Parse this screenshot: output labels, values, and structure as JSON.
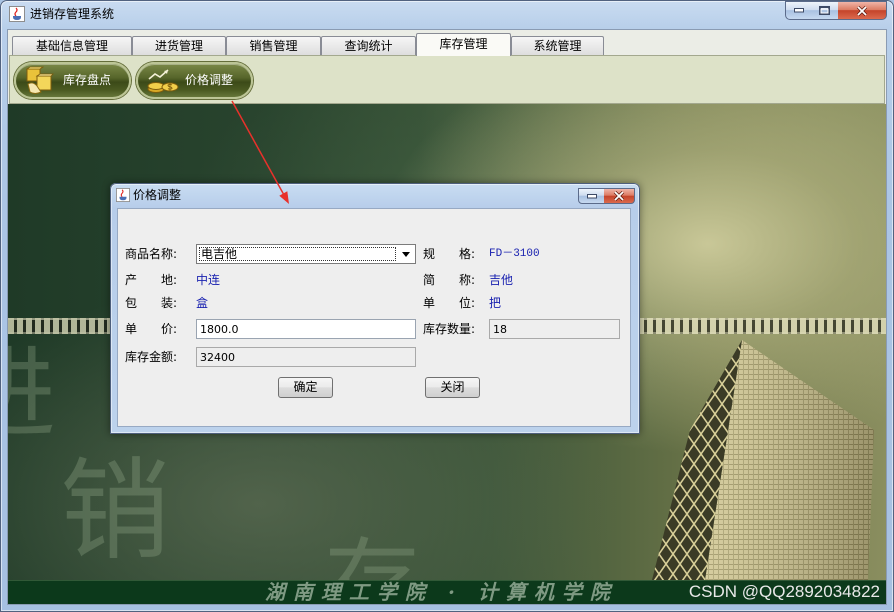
{
  "window": {
    "title": "进销存管理系统",
    "icon": "java-cup-icon",
    "controls": [
      "minimize-icon",
      "maximize-icon",
      "close-icon"
    ]
  },
  "tabs": [
    {
      "label": "基础信息管理",
      "selected": false
    },
    {
      "label": "进货管理",
      "selected": false
    },
    {
      "label": "销售管理",
      "selected": false
    },
    {
      "label": "查询统计",
      "selected": false
    },
    {
      "label": "库存管理",
      "selected": true
    },
    {
      "label": "系统管理",
      "selected": false
    }
  ],
  "toolbar": {
    "buttons": [
      {
        "label": "库存盘点",
        "icon": "inventory-boxes-icon"
      },
      {
        "label": "价格调整",
        "icon": "price-coins-icon"
      }
    ]
  },
  "background": {
    "watermark_chars": [
      "进",
      "销",
      "存"
    ],
    "banner_text": "湖南理工学院 · 计算机学院",
    "credit_text": "CSDN @QQ2892034822"
  },
  "dialog": {
    "title": "价格调整",
    "icon": "java-cup-icon",
    "controls": [
      "minimize-icon",
      "close-icon"
    ],
    "product_name": {
      "label": "商品名称:",
      "value": "电吉他"
    },
    "spec": {
      "label": "规　　格:",
      "value": "FD－3100"
    },
    "origin": {
      "label": "产　　地:",
      "value": "中连"
    },
    "short_name": {
      "label": "简　　称:",
      "value": "吉他"
    },
    "package": {
      "label": "包　　装:",
      "value": "盒"
    },
    "unit": {
      "label": "单　　位:",
      "value": "把"
    },
    "unit_price": {
      "label": "单　　价:",
      "value": "1800.0"
    },
    "stock_qty": {
      "label": "库存数量:",
      "value": "18"
    },
    "stock_amount": {
      "label": "库存金额:",
      "value": "32400"
    },
    "buttons": {
      "ok": "确定",
      "close": "关闭"
    }
  },
  "colors": {
    "value_text": "#1a22b0",
    "annotation_arrow": "#e8312b",
    "toolbar_button": "#4a5a22",
    "toolbar_panel": "#dde2c8",
    "banner": "#0c391b",
    "window_frame": "#b8cfea"
  }
}
